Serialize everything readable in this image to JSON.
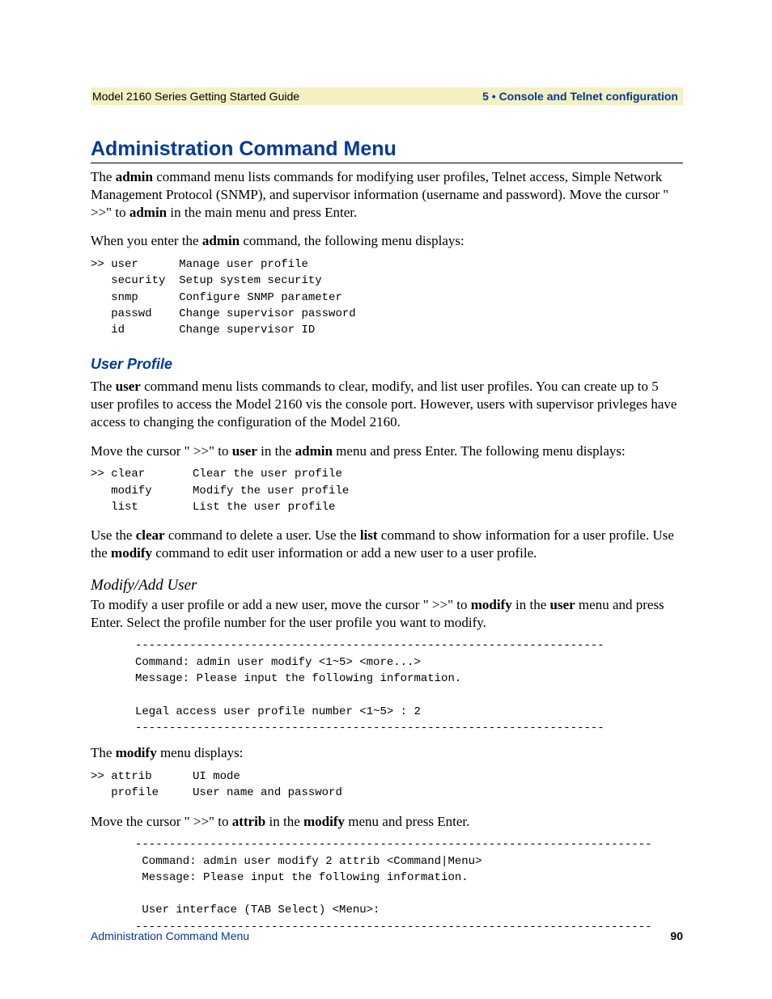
{
  "header": {
    "left": "Model 2160 Series Getting Started Guide",
    "right": "5 • Console and Telnet configuration"
  },
  "h1": "Administration Command Menu",
  "p1_a": "The ",
  "p1_b": "admin",
  "p1_c": " command menu lists commands for modifying user profiles, Telnet access, Simple Network Management Protocol (SNMP), and supervisor information (username and password). Move the cursor \" >>\" to ",
  "p1_d": "admin",
  "p1_e": " in the main menu and press Enter.",
  "p2_a": "When you enter the ",
  "p2_b": "admin",
  "p2_c": " command, the following menu displays:",
  "code1": ">> user      Manage user profile\n   security  Setup system security\n   snmp      Configure SNMP parameter\n   passwd    Change supervisor password\n   id        Change supervisor ID",
  "h2_user": "User Profile",
  "p3_a": "The ",
  "p3_b": "user",
  "p3_c": " command menu lists commands to clear, modify, and list user profiles. You can create up to 5 user profiles to access the Model 2160 vis the console port. However, users with supervisor privleges have access to changing the configuration of the Model 2160.",
  "p4_a": "Move the cursor \" >>\" to ",
  "p4_b": "user",
  "p4_c": " in the ",
  "p4_d": "admin",
  "p4_e": " menu and press Enter. The following menu displays:",
  "code2": ">> clear       Clear the user profile\n   modify      Modify the user profile\n   list        List the user profile",
  "p5_a": "Use the ",
  "p5_b": "clear",
  "p5_c": " command to delete a user. Use the ",
  "p5_d": "list",
  "p5_e": " command to show information for a user profile. Use the ",
  "p5_f": "modify",
  "p5_g": " command to edit user information or add a new user to a user profile.",
  "h3_modify": "Modify/Add User",
  "p6_a": "To modify a user profile or add a new user, move the cursor \" >>\" to ",
  "p6_b": "modify",
  "p6_c": " in the ",
  "p6_d": "user",
  "p6_e": " menu and press Enter. Select the profile number for the user profile you want to modify.",
  "code3": "---------------------------------------------------------------------\nCommand: admin user modify <1~5> <more...>\nMessage: Please input the following information.\n\nLegal access user profile number <1~5> : 2\n---------------------------------------------------------------------",
  "p7_a": "The ",
  "p7_b": "modify",
  "p7_c": " menu displays:",
  "code4": ">> attrib      UI mode\n   profile     User name and password",
  "p8_a": "Move the cursor \" >>\" to ",
  "p8_b": "attrib",
  "p8_c": " in the ",
  "p8_d": "modify",
  "p8_e": " menu and press Enter.",
  "code5": "----------------------------------------------------------------------------\n Command: admin user modify 2 attrib <Command|Menu>\n Message: Please input the following information.\n\n User interface (TAB Select) <Menu>:\n----------------------------------------------------------------------------",
  "footer": {
    "left": "Administration Command Menu",
    "right": "90"
  }
}
